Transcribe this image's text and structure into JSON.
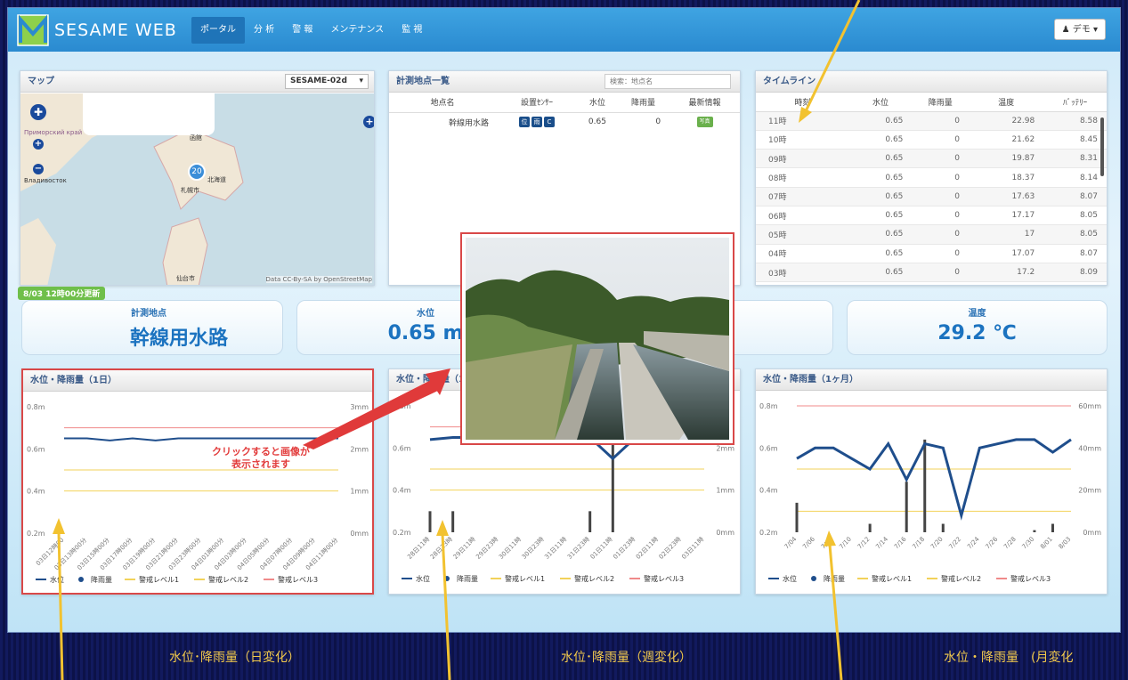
{
  "app": {
    "name": "SESAME WEB",
    "user_label": "デモ"
  },
  "nav": [
    {
      "label": "ポータル",
      "active": true
    },
    {
      "label": "分 析"
    },
    {
      "label": "警 報"
    },
    {
      "label": "メンテナンス"
    },
    {
      "label": "監 視"
    }
  ],
  "map_panel": {
    "title": "マップ",
    "select_value": "SESAME-02d",
    "marker_count": "20",
    "attribution": "Data CC-By-SA by OpenStreetMap",
    "place_labels": [
      "Приморский край",
      "Владивосток",
      "北海道",
      "札幌市",
      "仙台市",
      "函館"
    ]
  },
  "site_list": {
    "title": "計測地点一覧",
    "search_placeholder": "検索：地点名",
    "headers": [
      "地点名",
      "設置ｾﾝｻｰ",
      "水位",
      "降雨量",
      "最新情報"
    ],
    "rows": [
      {
        "name": "幹線用水路",
        "sensors": [
          "位",
          "雨",
          "C"
        ],
        "level": "0.65",
        "rain": "0",
        "latest": "写真"
      }
    ]
  },
  "timeline": {
    "title": "タイムライン",
    "headers": [
      "時刻",
      "水位",
      "降雨量",
      "温度",
      "ﾊﾞｯﾃﾘｰ"
    ],
    "rows": [
      [
        "11時",
        "0.65",
        "0",
        "22.98",
        "8.58"
      ],
      [
        "10時",
        "0.65",
        "0",
        "21.62",
        "8.45"
      ],
      [
        "09時",
        "0.65",
        "0",
        "19.87",
        "8.31"
      ],
      [
        "08時",
        "0.65",
        "0",
        "18.37",
        "8.14"
      ],
      [
        "07時",
        "0.65",
        "0",
        "17.63",
        "8.07"
      ],
      [
        "06時",
        "0.65",
        "0",
        "17.17",
        "8.05"
      ],
      [
        "05時",
        "0.65",
        "0",
        "17",
        "8.05"
      ],
      [
        "04時",
        "0.65",
        "0",
        "17.07",
        "8.07"
      ],
      [
        "03時",
        "0.65",
        "0",
        "17.2",
        "8.09"
      ]
    ]
  },
  "update_badge": "8/03 12時00分更新",
  "stats": {
    "site_label": "計測地点",
    "site_value": "幹線用水路",
    "level_label": "水位",
    "level_value": "0.65 m",
    "temp_label": "温度",
    "temp_value": "29.2 ℃"
  },
  "charts": {
    "day_title": "水位・降雨量（1日）",
    "week_title": "水位・降雨量（1週間）",
    "month_title": "水位・降雨量（1ヶ月）",
    "legend": [
      "水位",
      "降雨量",
      "警戒レベル1",
      "警戒レベル2",
      "警戒レベル3"
    ],
    "click_hint_line1": "クリックすると画像が",
    "click_hint_line2": "表示されます"
  },
  "bottom": {
    "day_label": "水位･降雨量（日変化）",
    "week_label": "水位･降雨量（週変化）",
    "month_label": "水位・降雨量　(月変化"
  },
  "chart_data": [
    {
      "type": "line",
      "title": "水位・降雨量（1日）",
      "y_left_ticks": [
        "0.8m",
        "0.6m",
        "0.4m",
        "0.2m"
      ],
      "y_right_ticks": [
        "3mm",
        "2mm",
        "1mm",
        "0mm"
      ],
      "ylim": [
        0.2,
        0.8
      ],
      "y2lim": [
        0,
        3
      ],
      "x": [
        "03日12時00",
        "03日13時00分",
        "03日15時00分",
        "03日17時00分",
        "03日19時00分",
        "03日21時00分",
        "03日23時00分",
        "04日01時00分",
        "04日03時00分",
        "04日05時00分",
        "04日07時00分",
        "04日09時00分",
        "04日11時00分"
      ],
      "series": [
        {
          "name": "水位",
          "values": [
            0.65,
            0.65,
            0.64,
            0.65,
            0.64,
            0.65,
            0.65,
            0.65,
            0.65,
            0.65,
            0.65,
            0.65,
            0.65
          ]
        },
        {
          "name": "降雨量",
          "values": [
            0,
            0,
            0,
            0,
            0,
            0,
            0,
            0,
            0,
            0,
            0,
            0,
            0
          ]
        }
      ],
      "thresholds": {
        "警戒レベル1": 0.4,
        "警戒レベル2": 0.5,
        "警戒レベル3": 0.7
      },
      "color": "#1f4e8c"
    },
    {
      "type": "line",
      "title": "水位・降雨量（1週間）",
      "y_left_ticks": [
        "0.8m",
        "0.6m",
        "0.4m",
        "0.2m"
      ],
      "y_right_ticks": [
        "3mm",
        "2mm",
        "1mm",
        "0mm"
      ],
      "ylim": [
        0.2,
        0.8
      ],
      "y2lim": [
        0,
        3
      ],
      "x": [
        "28日11時",
        "28日23時",
        "29日11時",
        "29日23時",
        "30日11時",
        "30日23時",
        "31日11時",
        "31日23時",
        "01日11時",
        "01日23時",
        "02日11時",
        "02日23時",
        "03日11時"
      ],
      "series": [
        {
          "name": "水位",
          "values": [
            0.64,
            0.65,
            0.65,
            0.65,
            0.65,
            0.65,
            0.65,
            0.65,
            0.55,
            0.65,
            0.65,
            0.65,
            0.65
          ]
        },
        {
          "name": "降雨量",
          "values": [
            0.5,
            0.5,
            0,
            0,
            0,
            0,
            0,
            0.5,
            2.5,
            0,
            0,
            0,
            0
          ]
        }
      ],
      "thresholds": {
        "警戒レベル1": 0.4,
        "警戒レベル2": 0.5,
        "警戒レベル3": 0.7
      }
    },
    {
      "type": "line",
      "title": "水位・降雨量（1ヶ月）",
      "y_left_ticks": [
        "0.8m",
        "0.6m",
        "0.4m",
        "0.2m"
      ],
      "y_right_ticks": [
        "60mm",
        "40mm",
        "20mm",
        "0mm"
      ],
      "ylim": [
        0.2,
        0.8
      ],
      "y2lim": [
        0,
        60
      ],
      "x": [
        "7/04",
        "7/06",
        "7/08",
        "7/10",
        "7/12",
        "7/14",
        "7/16",
        "7/18",
        "7/20",
        "7/22",
        "7/24",
        "7/26",
        "7/28",
        "7/30",
        "8/01",
        "8/03"
      ],
      "series": [
        {
          "name": "水位",
          "values": [
            0.55,
            0.6,
            0.6,
            0.55,
            0.5,
            0.62,
            0.45,
            0.62,
            0.6,
            0.28,
            0.6,
            0.62,
            0.64,
            0.64,
            0.58,
            0.64
          ]
        },
        {
          "name": "降雨量",
          "values": [
            14,
            0,
            0,
            0,
            4,
            0,
            24,
            44,
            4,
            0,
            0,
            0,
            0,
            1,
            4,
            0
          ]
        }
      ],
      "thresholds": {
        "警戒レベル1": 0.3,
        "警戒レベル2": 0.5,
        "警戒レベル3": 0.8
      }
    }
  ]
}
